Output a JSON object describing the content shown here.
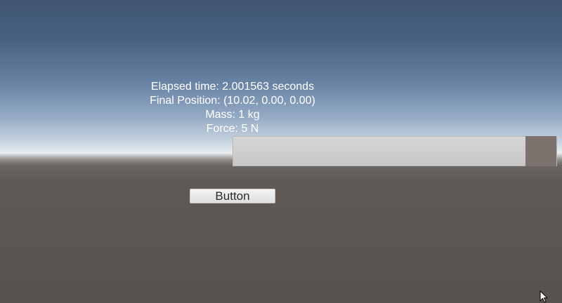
{
  "scene": {
    "info_lines": [
      "Elapsed time: 2.001563 seconds",
      "Final Position: (10.02, 0.00, 0.00)",
      "Mass: 1 kg",
      "Force: 5 N"
    ]
  },
  "slider": {
    "fill_fraction": 0.905
  },
  "button": {
    "label": "Button"
  },
  "icons": {
    "cursor": "mouse-pointer-icon"
  }
}
